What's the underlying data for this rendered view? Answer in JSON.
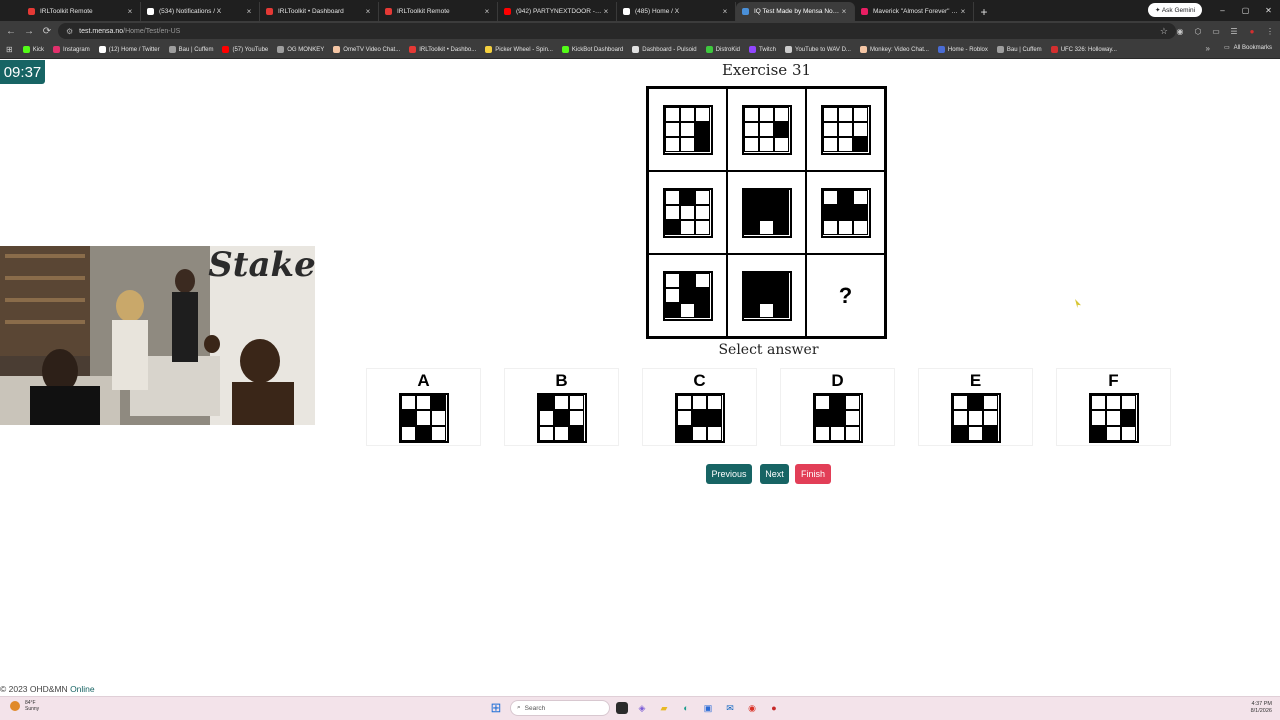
{
  "browser": {
    "tabs": [
      {
        "title": "IRLToolkit Remote",
        "color": "#e53935",
        "active": false
      },
      {
        "title": "(534) Notifications / X",
        "color": "#ffffff",
        "active": false
      },
      {
        "title": "IRLToolkit • Dashboard",
        "color": "#e53935",
        "active": false
      },
      {
        "title": "IRLToolkit Remote",
        "color": "#e53935",
        "active": false
      },
      {
        "title": "(942) PARTYNEXTDOOR - Only",
        "color": "#ff0000",
        "active": false
      },
      {
        "title": "(485) Home / X",
        "color": "#ffffff",
        "active": false
      },
      {
        "title": "IQ Test Made by Mensa Norwa",
        "color": "#4a90d9",
        "active": true
      },
      {
        "title": "Maverick \"Almost Forever\" EP",
        "color": "#e91e63",
        "active": false
      }
    ],
    "tab_close": "×",
    "new_tab": "+",
    "gemini_label": "✦ Ask Gemini",
    "window_controls": [
      "–",
      "▢",
      "✕"
    ],
    "nav": {
      "back": "←",
      "forward": "→",
      "reload": "⟳"
    },
    "address": {
      "host": "test.mensa.no",
      "path": "/Home/Test/en-US",
      "tune_icon": "⚙",
      "star": "☆"
    },
    "toolbar_icons": [
      "◉",
      "⬡",
      "▭",
      "☰",
      "●",
      "⋮"
    ],
    "bookmarks": [
      {
        "label": "Kick",
        "color": "#53fc18"
      },
      {
        "label": "Instagram",
        "color": "#e1306c"
      },
      {
        "label": "(12) Home / Twitter",
        "color": "#ffffff"
      },
      {
        "label": "Bau | Cuffem",
        "color": "#9e9e9e"
      },
      {
        "label": "(57) YouTube",
        "color": "#ff0000"
      },
      {
        "label": "OG MONKEY",
        "color": "#9e9e9e"
      },
      {
        "label": "OmeTV Video Chat...",
        "color": "#f5c6a5"
      },
      {
        "label": "IRLToolkit • Dashbo...",
        "color": "#e53935"
      },
      {
        "label": "Picker Wheel - Spin...",
        "color": "#f4d03f"
      },
      {
        "label": "KickBot Dashboard",
        "color": "#53fc18"
      },
      {
        "label": "Dashboard - Pulsoid",
        "color": "#e0e0e0"
      },
      {
        "label": "DistroKid",
        "color": "#3ec93e"
      },
      {
        "label": "Twitch",
        "color": "#9146ff"
      },
      {
        "label": "YouTube to WAV D...",
        "color": "#cccccc"
      },
      {
        "label": "Monkey: Video Chat...",
        "color": "#f5c6a5"
      },
      {
        "label": "Home - Roblox",
        "color": "#4a6cd4"
      },
      {
        "label": "Bau | Cuffem",
        "color": "#9e9e9e"
      },
      {
        "label": "UFC 326: Holloway...",
        "color": "#d32f2f"
      }
    ],
    "apps_icon": "⊞",
    "more_bookmarks": "»",
    "all_bookmarks": "All Bookmarks"
  },
  "page": {
    "timer": "09:37",
    "exercise_title": "Exercise 31",
    "matrix": [
      {
        "cells": [
          5,
          8
        ]
      },
      {
        "cells": [
          5
        ]
      },
      {
        "cells": [
          8
        ]
      },
      {
        "cells": [
          1,
          6
        ]
      },
      {
        "cells": [
          0,
          1,
          2,
          3,
          4,
          5,
          6,
          8
        ]
      },
      {
        "cells": [
          1,
          3,
          4,
          5
        ]
      },
      {
        "cells": [
          1,
          4,
          5,
          6,
          8
        ]
      },
      {
        "cells": [
          0,
          1,
          2,
          3,
          4,
          5,
          6,
          8
        ]
      },
      {
        "question": "?"
      }
    ],
    "select_answer": "Select answer",
    "options": [
      {
        "label": "A",
        "cells": [
          2,
          3,
          7
        ]
      },
      {
        "label": "B",
        "cells": [
          0,
          4,
          8
        ]
      },
      {
        "label": "C",
        "cells": [
          4,
          5,
          6
        ]
      },
      {
        "label": "D",
        "cells": [
          1,
          3,
          4
        ]
      },
      {
        "label": "E",
        "cells": [
          1,
          6,
          8
        ]
      },
      {
        "label": "F",
        "cells": [
          5,
          6
        ]
      }
    ],
    "buttons": {
      "previous": "Previous",
      "next": "Next",
      "finish": "Finish"
    },
    "footer": {
      "copyright": "© 2023 OHD&MN",
      "link": "Online"
    }
  },
  "taskbar": {
    "weather_temp": "84°F",
    "weather_desc": "Sunny",
    "search_placeholder": "Search",
    "time": "4:37 PM",
    "date": "8/1/2026"
  },
  "colors": {
    "accent": "#176464",
    "finish": "#e23e57"
  }
}
